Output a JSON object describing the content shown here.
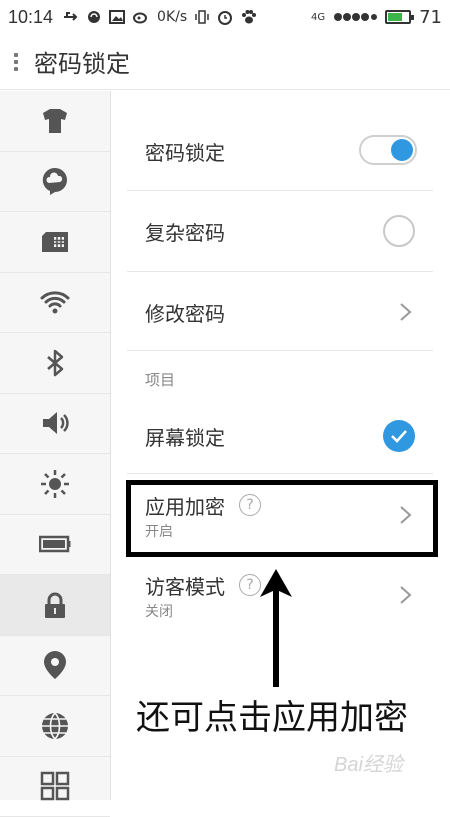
{
  "status_bar": {
    "time": "10:14",
    "network_speed": "0K/s",
    "signal_type": "4G",
    "battery_level": "71"
  },
  "header": {
    "title": "密码锁定"
  },
  "sidebar": {
    "items": [
      {
        "icon": "tshirt-icon"
      },
      {
        "icon": "cloud-chat-icon"
      },
      {
        "icon": "sim-card-icon"
      },
      {
        "icon": "wifi-icon"
      },
      {
        "icon": "bluetooth-icon"
      },
      {
        "icon": "volume-icon"
      },
      {
        "icon": "brightness-icon"
      },
      {
        "icon": "battery-icon"
      },
      {
        "icon": "lock-icon",
        "active": true
      },
      {
        "icon": "location-icon"
      },
      {
        "icon": "globe-icon"
      },
      {
        "icon": "apps-grid-icon"
      }
    ]
  },
  "settings": {
    "password_lock": {
      "label": "密码锁定",
      "enabled": true
    },
    "complex_password": {
      "label": "复杂密码",
      "checked": false
    },
    "change_password": {
      "label": "修改密码"
    },
    "section_items": "项目",
    "screen_lock": {
      "label": "屏幕锁定",
      "checked": true
    },
    "app_encryption": {
      "label": "应用加密",
      "status": "开启"
    },
    "guest_mode": {
      "label": "访客模式",
      "status": "关闭"
    }
  },
  "annotation": {
    "text": "还可点击应用加密",
    "watermark": "Bai经验"
  },
  "colors": {
    "accent": "#2f98e0",
    "battery_fill": "#3bb54a"
  }
}
